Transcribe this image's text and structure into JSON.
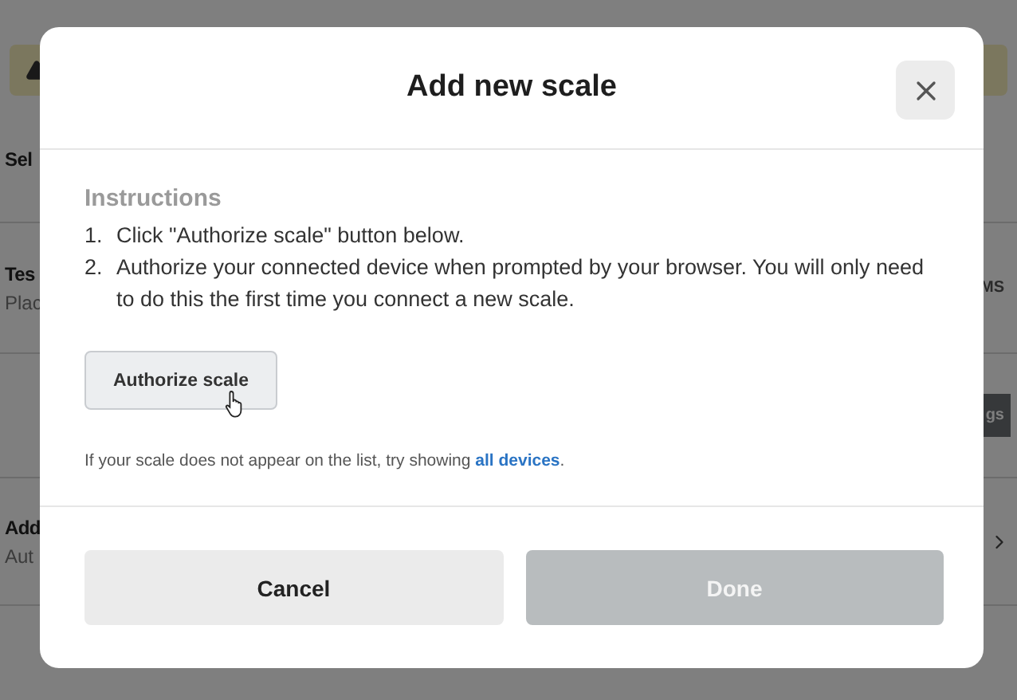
{
  "background": {
    "banner": {
      "kind": "warning"
    },
    "rows": [
      {
        "title": "Sel"
      },
      {
        "title": "Tes",
        "subtitle": "Plac",
        "action": "MS",
        "filled": false
      },
      {
        "action": "gs",
        "filled": true
      },
      {
        "title": "Add",
        "subtitle": "Aut",
        "chevron": true
      }
    ]
  },
  "dialog": {
    "title": "Add new scale",
    "instructions_heading": "Instructions",
    "steps": [
      {
        "number": "1.",
        "text": "Click \"Authorize scale\" button below."
      },
      {
        "number": "2.",
        "text": "Authorize your connected device when prompted by your browser. You will only need to do this the first time you connect a new scale."
      }
    ],
    "authorize_button": "Authorize scale",
    "hint": {
      "text": "If your scale does not appear on the list, try showing ",
      "link": "all devices",
      "after": "."
    },
    "buttons": [
      {
        "label": "Cancel",
        "disabled": false
      },
      {
        "label": "Done",
        "disabled": true
      }
    ]
  }
}
